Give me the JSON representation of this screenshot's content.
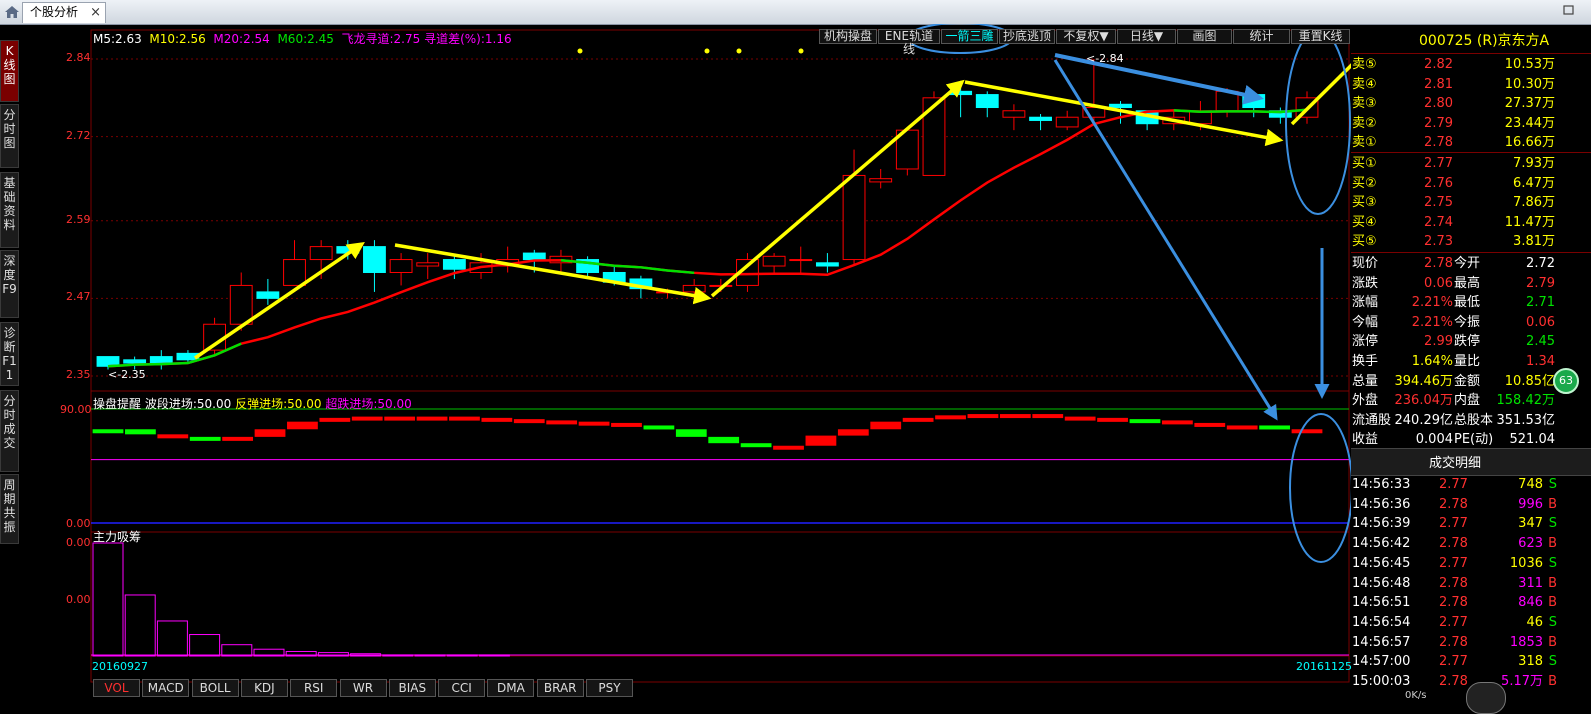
{
  "window": {
    "tab_title": "个股分析",
    "tab_close": "×"
  },
  "left_tabs": [
    {
      "label": "K线图",
      "active": true
    },
    {
      "label": "分时图",
      "active": false
    },
    {
      "label": "基础资料",
      "active": false
    },
    {
      "label": "深度F9",
      "active": false
    },
    {
      "label": "诊断F11",
      "active": false
    },
    {
      "label": "分时成交",
      "active": false
    },
    {
      "label": "周期共振",
      "active": false
    }
  ],
  "ma_legend": {
    "m5": "M5:2.63",
    "m10": "M10:2.56",
    "m20": "M20:2.54",
    "m60": "M60:2.45",
    "channel": "飞龙寻道:2.75",
    "channel_diff": "寻道差(%):1.16"
  },
  "toolbar": [
    "机构操盘",
    "ENE轨道线",
    "一箭三雕",
    "抄底逃顶",
    "不复权▼",
    "日线▼",
    "画图",
    "统计",
    "重置K线"
  ],
  "price_axis": {
    "ticks": [
      "2.84",
      "2.72",
      "2.59",
      "2.47",
      "2.35"
    ],
    "high_label": "<-2.84",
    "low_label": "<-2.35"
  },
  "indicator1": {
    "title": "操盘提醒",
    "wave": "波段进场:50.00",
    "rebound": "反弹进场:50.00",
    "oversold": "超跌进场:50.00",
    "top_tick": "90.00",
    "bottom_tick": "0.00"
  },
  "indicator2": {
    "title": "主力吸筹",
    "top_tick": "0.00",
    "mid_tick": "0.00"
  },
  "date_range": {
    "start": "20160927",
    "end": "20161125"
  },
  "index_tabs": [
    "VOL",
    "MACD",
    "BOLL",
    "KDJ",
    "RSI",
    "WR",
    "BIAS",
    "CCI",
    "DMA",
    "BRAR",
    "PSY"
  ],
  "stock": {
    "code_name": "000725 (R)京东方A"
  },
  "order_book": {
    "asks": [
      {
        "label": "卖⑤",
        "price": "2.82",
        "vol": "10.53万"
      },
      {
        "label": "卖④",
        "price": "2.81",
        "vol": "10.30万"
      },
      {
        "label": "卖③",
        "price": "2.80",
        "vol": "27.37万"
      },
      {
        "label": "卖②",
        "price": "2.79",
        "vol": "23.44万"
      },
      {
        "label": "卖①",
        "price": "2.78",
        "vol": "16.66万"
      }
    ],
    "bids": [
      {
        "label": "买①",
        "price": "2.77",
        "vol": "7.93万"
      },
      {
        "label": "买②",
        "price": "2.76",
        "vol": "6.47万"
      },
      {
        "label": "买③",
        "price": "2.75",
        "vol": "7.86万"
      },
      {
        "label": "买④",
        "price": "2.74",
        "vol": "11.47万"
      },
      {
        "label": "买⑤",
        "price": "2.73",
        "vol": "3.81万"
      }
    ]
  },
  "quote": [
    {
      "l1": "现价",
      "v1": "2.78",
      "c1": "red",
      "l2": "今开",
      "v2": "2.72",
      "c2": "white"
    },
    {
      "l1": "涨跌",
      "v1": "0.06",
      "c1": "red",
      "l2": "最高",
      "v2": "2.79",
      "c2": "red"
    },
    {
      "l1": "涨幅",
      "v1": "2.21%",
      "c1": "red",
      "l2": "最低",
      "v2": "2.71",
      "c2": "green"
    },
    {
      "l1": "今幅",
      "v1": "2.21%",
      "c1": "red",
      "l2": "今振",
      "v2": "0.06",
      "c2": "red"
    },
    {
      "l1": "涨停",
      "v1": "2.99",
      "c1": "red",
      "l2": "跌停",
      "v2": "2.45",
      "c2": "green"
    },
    {
      "l1": "换手",
      "v1": "1.64%",
      "c1": "yellow",
      "l2": "量比",
      "v2": "1.34",
      "c2": "red"
    },
    {
      "l1": "总量",
      "v1": "394.46万",
      "c1": "yellow",
      "l2": "金额",
      "v2": "10.85亿",
      "c2": "yellow"
    },
    {
      "l1": "外盘",
      "v1": "236.04万",
      "c1": "red",
      "l2": "内盘",
      "v2": "158.42万",
      "c2": "green"
    },
    {
      "l1": "流通股",
      "v1": "240.29亿",
      "c1": "white",
      "l2": "总股本",
      "v2": "351.53亿",
      "c2": "white"
    },
    {
      "l1": "收益",
      "v1": "0.004",
      "c1": "white",
      "l2": "PE(动)",
      "v2": "521.04",
      "c2": "white"
    }
  ],
  "trades_title": "成交明细",
  "trades": [
    {
      "time": "14:56:33",
      "price": "2.77",
      "vol": "748",
      "side": "S"
    },
    {
      "time": "14:56:36",
      "price": "2.78",
      "vol": "996",
      "side": "B"
    },
    {
      "time": "14:56:39",
      "price": "2.77",
      "vol": "347",
      "side": "S"
    },
    {
      "time": "14:56:42",
      "price": "2.78",
      "vol": "623",
      "side": "B"
    },
    {
      "time": "14:56:45",
      "price": "2.77",
      "vol": "1036",
      "side": "S"
    },
    {
      "time": "14:56:48",
      "price": "2.78",
      "vol": "311",
      "side": "B"
    },
    {
      "time": "14:56:51",
      "price": "2.78",
      "vol": "846",
      "side": "B"
    },
    {
      "time": "14:56:54",
      "price": "2.77",
      "vol": "46",
      "side": "S"
    },
    {
      "time": "14:56:57",
      "price": "2.78",
      "vol": "1853",
      "side": "B"
    },
    {
      "time": "14:57:00",
      "price": "2.77",
      "vol": "318",
      "side": "S"
    },
    {
      "time": "15:00:03",
      "price": "2.78",
      "vol": "5.17万",
      "side": "B"
    }
  ],
  "badge": "63",
  "net_speed": "0K/s",
  "colors": {
    "up": "#ff0000",
    "down": "#00ffff",
    "arrow_yellow": "#ffff00",
    "arrow_blue": "#3b8fe0",
    "ma_red": "#ff0000",
    "ma_green": "#00e000"
  },
  "candles": [
    [
      2.38,
      2.365,
      2.375,
      2.36
    ],
    [
      2.375,
      2.37,
      2.38,
      2.36
    ],
    [
      2.38,
      2.37,
      2.39,
      2.36
    ],
    [
      2.385,
      2.375,
      2.39,
      2.37
    ],
    [
      2.39,
      2.43,
      2.44,
      2.38
    ],
    [
      2.43,
      2.49,
      2.51,
      2.42
    ],
    [
      2.48,
      2.47,
      2.5,
      2.46
    ],
    [
      2.49,
      2.53,
      2.56,
      2.49
    ],
    [
      2.53,
      2.55,
      2.56,
      2.5
    ],
    [
      2.55,
      2.54,
      2.56,
      2.53
    ],
    [
      2.55,
      2.51,
      2.56,
      2.48
    ],
    [
      2.51,
      2.53,
      2.54,
      2.49
    ],
    [
      2.52,
      2.525,
      2.54,
      2.5
    ],
    [
      2.53,
      2.515,
      2.535,
      2.5
    ],
    [
      2.51,
      2.525,
      2.54,
      2.5
    ],
    [
      2.52,
      2.53,
      2.55,
      2.51
    ],
    [
      2.54,
      2.53,
      2.545,
      2.51
    ],
    [
      2.525,
      2.535,
      2.545,
      2.51
    ],
    [
      2.53,
      2.51,
      2.535,
      2.5
    ],
    [
      2.51,
      2.495,
      2.52,
      2.49
    ],
    [
      2.5,
      2.485,
      2.505,
      2.47
    ],
    [
      2.48,
      2.48,
      2.485,
      2.47
    ],
    [
      2.48,
      2.49,
      2.5,
      2.47
    ],
    [
      2.49,
      2.49,
      2.5,
      2.48
    ],
    [
      2.49,
      2.53,
      2.54,
      2.48
    ],
    [
      2.52,
      2.535,
      2.54,
      2.51
    ],
    [
      2.53,
      2.53,
      2.55,
      2.51
    ],
    [
      2.525,
      2.52,
      2.54,
      2.51
    ],
    [
      2.53,
      2.66,
      2.7,
      2.52
    ],
    [
      2.65,
      2.655,
      2.67,
      2.64
    ],
    [
      2.67,
      2.73,
      2.73,
      2.66
    ],
    [
      2.66,
      2.78,
      2.79,
      2.66
    ],
    [
      2.79,
      2.785,
      2.8,
      2.75
    ],
    [
      2.785,
      2.765,
      2.79,
      2.75
    ],
    [
      2.75,
      2.76,
      2.77,
      2.73
    ],
    [
      2.75,
      2.745,
      2.755,
      2.73
    ],
    [
      2.735,
      2.75,
      2.76,
      2.73
    ],
    [
      2.75,
      2.765,
      2.84,
      2.74
    ],
    [
      2.77,
      2.765,
      2.775,
      2.74
    ],
    [
      2.76,
      2.74,
      2.76,
      2.73
    ],
    [
      2.74,
      2.75,
      2.76,
      2.73
    ],
    [
      2.74,
      2.76,
      2.775,
      2.73
    ],
    [
      2.76,
      2.79,
      2.795,
      2.75
    ],
    [
      2.785,
      2.765,
      2.79,
      2.75
    ],
    [
      2.76,
      2.75,
      2.765,
      2.74
    ],
    [
      2.75,
      2.78,
      2.79,
      2.74
    ]
  ],
  "indicator_bars": [
    {
      "v": 74,
      "c": "g"
    },
    {
      "v": 70,
      "c": "g"
    },
    {
      "v": 68,
      "c": "r"
    },
    {
      "v": 68,
      "c": "g"
    },
    {
      "v": 68,
      "c": "r"
    },
    {
      "v": 74,
      "c": "r"
    },
    {
      "v": 80,
      "c": "r"
    },
    {
      "v": 83,
      "c": "r"
    },
    {
      "v": 84,
      "c": "r"
    },
    {
      "v": 84,
      "c": "r"
    },
    {
      "v": 84,
      "c": "r"
    },
    {
      "v": 83,
      "c": "r"
    },
    {
      "v": 82,
      "c": "r"
    },
    {
      "v": 81,
      "c": "r"
    },
    {
      "v": 80,
      "c": "r"
    },
    {
      "v": 79,
      "c": "r"
    },
    {
      "v": 77,
      "c": "r"
    },
    {
      "v": 74,
      "c": "g"
    },
    {
      "v": 68,
      "c": "g"
    },
    {
      "v": 63,
      "c": "g"
    },
    {
      "v": 61,
      "c": "g"
    },
    {
      "v": 61,
      "c": "r"
    },
    {
      "v": 69,
      "c": "r"
    },
    {
      "v": 74,
      "c": "r"
    },
    {
      "v": 80,
      "c": "r"
    },
    {
      "v": 83,
      "c": "r"
    },
    {
      "v": 85,
      "c": "r"
    },
    {
      "v": 86,
      "c": "r"
    },
    {
      "v": 86,
      "c": "r"
    },
    {
      "v": 84,
      "c": "r"
    },
    {
      "v": 83,
      "c": "r"
    },
    {
      "v": 82,
      "c": "r"
    },
    {
      "v": 81,
      "c": "g"
    },
    {
      "v": 79,
      "c": "r"
    },
    {
      "v": 77,
      "c": "r"
    },
    {
      "v": 77,
      "c": "r"
    },
    {
      "v": 74,
      "c": "g"
    },
    {
      "v": 72,
      "c": "r"
    }
  ],
  "volume_bars": [
    100,
    54,
    31,
    19,
    10,
    6,
    4,
    3,
    2,
    1,
    1,
    1,
    1
  ]
}
